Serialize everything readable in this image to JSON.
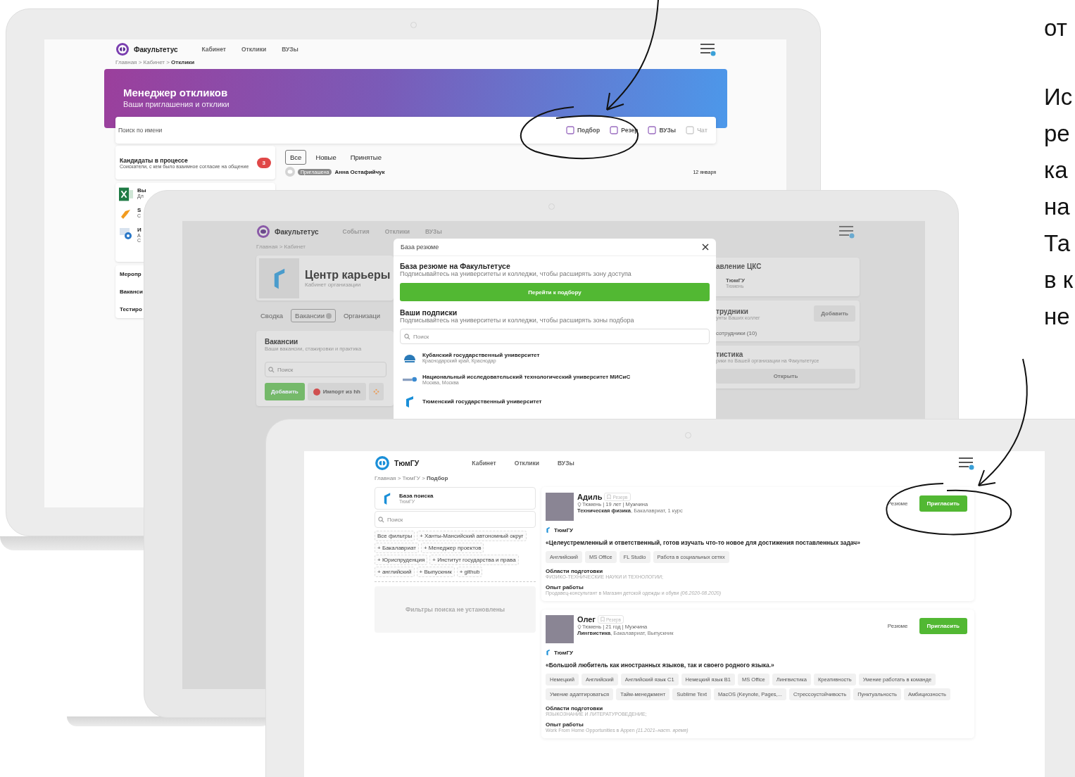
{
  "screen_1": {
    "logo": "Факультетус",
    "nav": [
      "Кабинет",
      "Отклики",
      "ВУЗы"
    ],
    "breadcrumbs": "Главная > Кабинет > **Отклики**",
    "banner": {
      "title": "Менеджер откликов",
      "subtitle": "Ваши приглашения и отклики"
    },
    "search": {
      "placeholder": "Поиск по имени"
    },
    "tools": [
      {
        "label": "Подбор",
        "disabled": false
      },
      {
        "label": "Резер",
        "disabled": false
      },
      {
        "label": "ВУЗы",
        "disabled": false
      },
      {
        "label": "Чат",
        "disabled": true
      }
    ],
    "candidates_card": {
      "title": "Кандидаты в процессе",
      "subtitle": "Соискатели, с кем было взаимное согласие на общение",
      "count": "3"
    },
    "integrations": [
      {
        "kind": "excel",
        "title": "Вы",
        "subtitle": [
          "Дл"
        ]
      },
      {
        "kind": "blocks",
        "title": "S",
        "subtitle": [
          "С"
        ]
      },
      {
        "kind": "api",
        "title": "И",
        "subtitle": [
          "А",
          "С"
        ]
      }
    ],
    "menu": [
      "Меропр",
      "Ваканси",
      "Тестиро"
    ],
    "filter_tabs": [
      {
        "label": "Все",
        "selected": true
      },
      {
        "label": "Новые",
        "selected": false
      },
      {
        "label": "Принятые",
        "selected": false
      }
    ],
    "response": {
      "tag": "Приглашена",
      "name": "Анна Остафийчук",
      "date": "12 января"
    }
  },
  "screen_2": {
    "logo": "Факультетус",
    "nav": [
      "События",
      "Отклики",
      "ВУЗы"
    ],
    "breadcrumbs": "Главная > Кабинет",
    "org": {
      "title": "Центр карьеры",
      "subtitle": "Кабинет организации"
    },
    "tabs": [
      {
        "label": "Сводка",
        "selected": false
      },
      {
        "label": "Вакансии",
        "selected": true
      },
      {
        "label": "Организаци",
        "selected": false
      }
    ],
    "vacancies": {
      "title": "Вакансии",
      "subtitle": "Ваши вакансии, стажировки и практика",
      "placeholder": "Поиск",
      "add": "Добавить",
      "import": "Импорт из hh"
    },
    "modal": {
      "title": "База резюме",
      "section_title": "База резюме на Факультетусе",
      "section_text": "Подписывайтесь на университеты и колледжи, чтобы расширять зону доступа",
      "button": "Перейти к подбору",
      "subs_title": "Ваши подписки",
      "subs_text": "Подписывайтесь на университеты и колледжи, чтобы расширять зоны подбора",
      "placeholder": "Поиск",
      "universities": [
        {
          "kind": "emblem",
          "name": "Кубанский государственный университет",
          "place": "Краснодарский край, Краснодар"
        },
        {
          "kind": "misis",
          "name": "Национальный исследовательский технологический университет МИСиС",
          "place": "Москва, Москва"
        },
        {
          "kind": "tyumen",
          "name": "Тюменский государственный университет"
        }
      ]
    },
    "right_cards": {
      "management": {
        "title": "авление ЦКС",
        "org": "ТюмГУ",
        "city": "Тюмень"
      },
      "staff": {
        "title": "трудники",
        "subtitle": "унты Ваших коллег",
        "button": "Добавить",
        "link": "сотрудники (10)"
      },
      "stats": {
        "title": "тистика",
        "subtitle": "рики по Вашей организации на Факультетусе",
        "button": "Открыть"
      }
    }
  },
  "screen_3": {
    "logo": "ТюмГУ",
    "nav": [
      "Кабинет",
      "Отклики",
      "ВУЗы"
    ],
    "breadcrumbs": "Главная > ТюмГУ > **Подбор**",
    "base": {
      "title": "База поиска",
      "subtitle": "ТюмГУ"
    },
    "search": {
      "placeholder": "Поиск"
    },
    "filters": [
      "Все фильтры",
      "+ Ханты-Мансийский автономный округ",
      "+ Бакалавриат",
      "+ Менеджер проектов",
      "+ Юриспруденция",
      "+ Институт государства и права",
      "+ английский",
      "+ Выпускник",
      "+ github"
    ],
    "empty": "Фильтры поиска не установлены",
    "candidates": [
      {
        "name": "Адиль",
        "reserve": "Резерв",
        "meta": "Тюмень | 19 лет | Мужчина",
        "program": "**Техническая физика**, Бакалавриат, 1 курс",
        "university": "ТюмГУ",
        "quote": "«Целеустремленный и ответственный, готов изучать что-то новое для достижения поставленных задач»",
        "skills": [
          "Английский",
          "MS Office",
          "FL Studio",
          "Работа в социальных сетях"
        ],
        "areas_label": "Области подготовки",
        "areas": "ФИЗИКО-ТЕХНИЧЕСКИЕ НАУКИ И ТЕХНОЛОГИИ;",
        "work_label": "Опыт работы",
        "work": "Продавец-консультант в Магазин детской одежды и обуви *(06.2020-08.2020)*",
        "resume": "Резюме",
        "invite": "Пригласить"
      },
      {
        "name": "Олег",
        "reserve": "Резерв",
        "meta": "Тюмень | 21 год | Мужчина",
        "program": "**Лингвистика**, Бакалавриат, Выпускник",
        "university": "ТюмГУ",
        "quote": "«Большой любитель как иностранных языков, так и своего родного языка.»",
        "skills": [
          "Немецкий",
          "Английский",
          "Английский язык C1",
          "Немецкий язык B1",
          "MS Office",
          "Лингвистика",
          "Креативность",
          "Умение работать в команде",
          "Умение адаптироваться",
          "Тайм-менеджмент",
          "Sublime Text",
          "MacOS (Keynote, Pages,...",
          "Стрессоустойчивость",
          "Пунктуальность",
          "Амбициозность"
        ],
        "areas_label": "Области подготовки",
        "areas": "ЯЗЫКОЗНАНИЕ И ЛИТЕРАТУРОВЕДЕНИЕ;",
        "work_label": "Опыт работы",
        "work": "Work From Home Opportunities в Appen *(11.2021–наст. время)*",
        "resume": "Резюме",
        "invite": "Пригласить"
      }
    ]
  },
  "side_text": [
    "от",
    "Ис",
    "ре",
    "ка",
    "на",
    "Та",
    "в к",
    "не"
  ]
}
